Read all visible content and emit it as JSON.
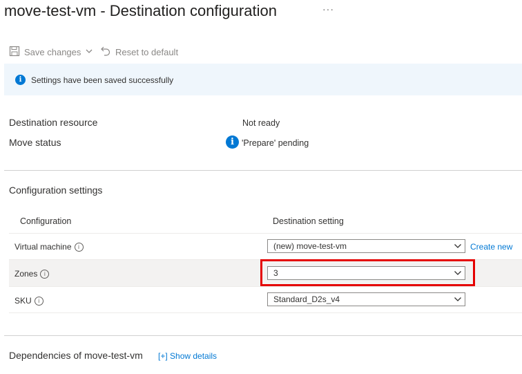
{
  "header": {
    "title": "move-test-vm - Destination configuration",
    "more": "···"
  },
  "toolbar": {
    "save_label": "Save changes",
    "reset_label": "Reset to default"
  },
  "banner": {
    "message": "Settings have been saved successfully"
  },
  "summary": {
    "destination_resource_label": "Destination resource",
    "destination_resource_value": "Not ready",
    "move_status_label": "Move status",
    "move_status_value": "'Prepare' pending"
  },
  "config": {
    "section_title": "Configuration settings",
    "columns": [
      "Configuration",
      "Destination setting"
    ],
    "rows": [
      {
        "label": "Virtual machine",
        "value": "(new) move-test-vm",
        "link": "Create new"
      },
      {
        "label": "Zones",
        "value": "3"
      },
      {
        "label": "SKU",
        "value": "Standard_D2s_v4"
      }
    ]
  },
  "dependencies": {
    "title": "Dependencies of move-test-vm",
    "link": "[+] Show details"
  },
  "colors": {
    "accent": "#0078d4",
    "highlight": "#e50000",
    "banner_bg": "#eff6fc"
  }
}
